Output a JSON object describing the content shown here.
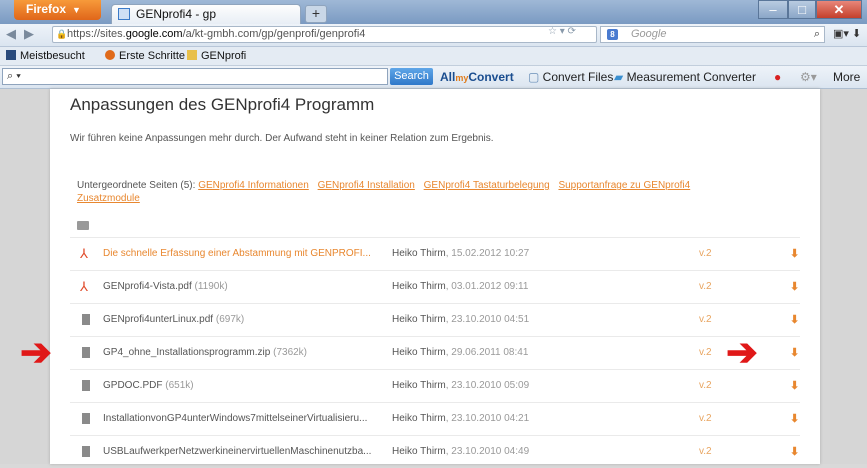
{
  "browser": {
    "menu_label": "Firefox",
    "tab_title": "GENprofi4 - gp",
    "newtab": "+",
    "url_prefix": "https://sites.",
    "url_domain": "google.com",
    "url_path": "/a/kt-gmbh.com/gp/genprofi/genprofi4",
    "search_placeholder": "Google",
    "bookmarks": [
      "Meistbesucht",
      "Erste Schritte",
      "GENprofi"
    ],
    "toolbar": {
      "search_button": "Search",
      "allmy_label": "All",
      "allmy_sub": "my",
      "convert_label": "Convert",
      "convert_files": "Convert Files",
      "measurement": "Measurement Converter",
      "more": "More"
    },
    "colors": {
      "accent": "#e8872f",
      "search_blue": "#2f78c9"
    }
  },
  "page": {
    "title": "Anpassungen des GENprofi4 Programm",
    "intro": "Wir führen keine Anpassungen mehr durch. Der Aufwand steht in keiner Relation zum Ergebnis.",
    "subpages_label": "Untergeordnete Seiten (5):",
    "subpages": [
      "GENprofi4 Informationen",
      "GENprofi4 Installation",
      "GENprofi4 Tastaturbelegung",
      "Supportanfrage zu GENprofi4",
      "Zusatzmodule"
    ],
    "files": [
      {
        "name": "Die schnelle Erfassung einer Abstammung mit GENPROFI...",
        "size": "",
        "icon": "pdf-icon",
        "user": "Heiko Thirm",
        "date": "15.02.2012 10:27",
        "version": "v.2"
      },
      {
        "name": "GENprofi4-Vista.pdf",
        "size": "(1190k)",
        "icon": "pdf-icon",
        "user": "Heiko Thirm",
        "date": "03.01.2012 09:11",
        "version": "v.2"
      },
      {
        "name": "GENprofi4unterLinux.pdf",
        "size": "(697k)",
        "icon": "document-icon",
        "user": "Heiko Thirm",
        "date": "23.10.2010 04:51",
        "version": "v.2"
      },
      {
        "name": "GP4_ohne_Installationsprogramm.zip",
        "size": "(7362k)",
        "icon": "document-icon",
        "user": "Heiko Thirm",
        "date": "29.06.2011 08:41",
        "version": "v.2"
      },
      {
        "name": "GPDOC.PDF",
        "size": "(651k)",
        "icon": "document-icon",
        "user": "Heiko Thirm",
        "date": "23.10.2010 05:09",
        "version": "v.2"
      },
      {
        "name": "InstallationvonGP4unterWindows7mittelseinerVirtualisieru...",
        "size": "",
        "icon": "document-icon",
        "user": "Heiko Thirm",
        "date": "23.10.2010 04:21",
        "version": "v.2"
      },
      {
        "name": "USBLaufwerkperNetzwerkineinervirtuellenMaschinenutzba...",
        "size": "",
        "icon": "document-icon",
        "user": "Heiko Thirm",
        "date": "23.10.2010 04:49",
        "version": "v.2"
      }
    ]
  }
}
